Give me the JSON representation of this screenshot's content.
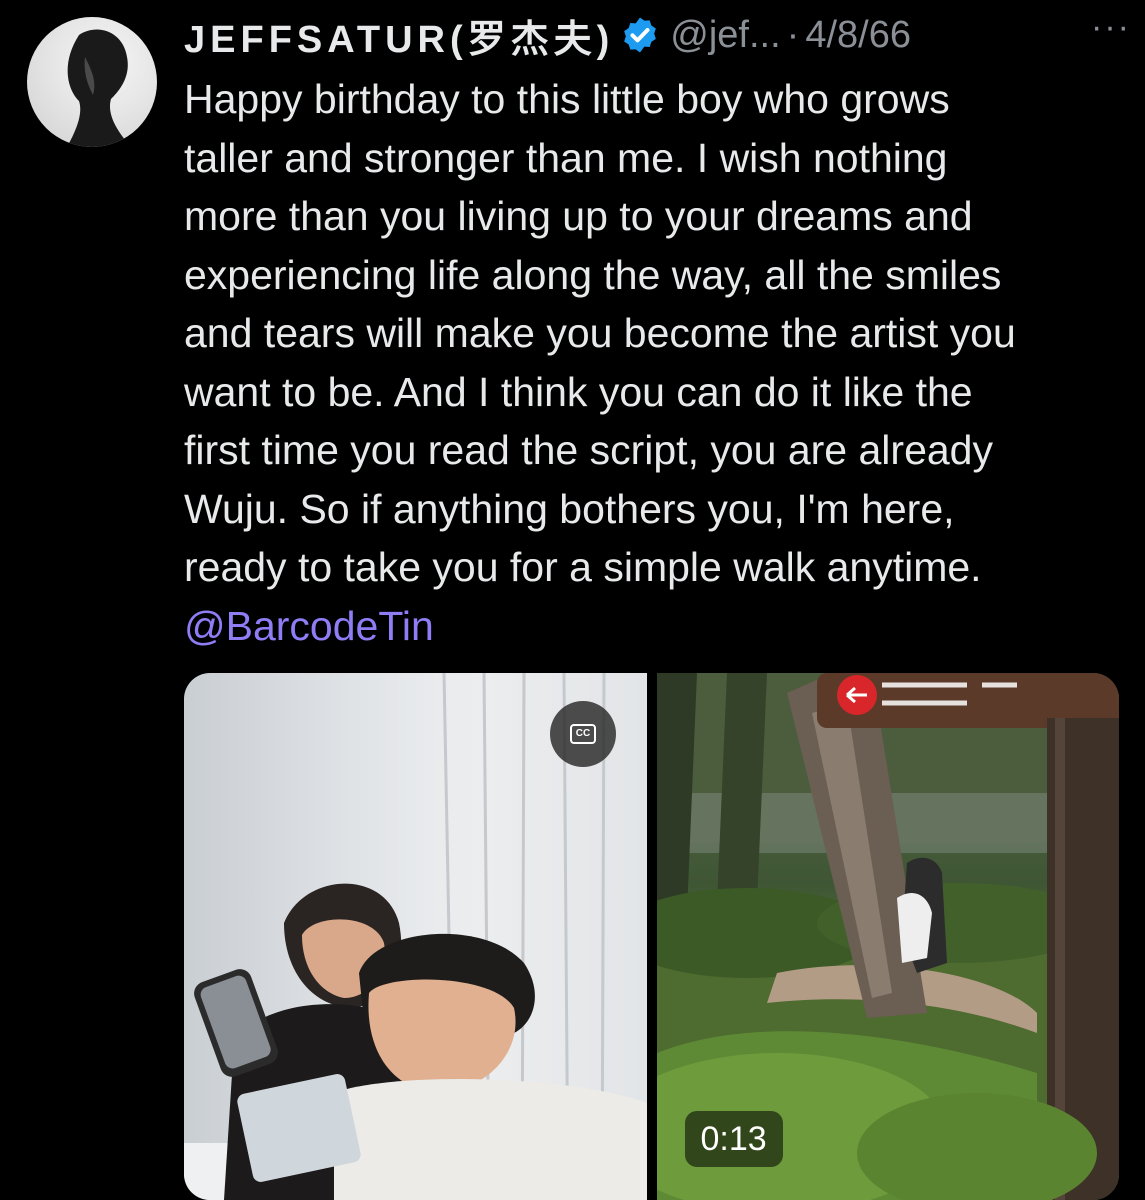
{
  "tweet": {
    "author": {
      "display_name": "JEFFSATUR(罗杰夫)",
      "handle": "@jef...",
      "verified": true,
      "avatar_icon": "profile-photo"
    },
    "separator": "·",
    "date": "4/8/66",
    "more_label": "···",
    "text_lines": [
      "Happy birthday to this little boy who grows",
      "taller and stronger than me. I wish nothing",
      "more than you living up to your dreams and",
      "experiencing life along the way, all the smiles",
      "and tears will make you become the artist you",
      "want to be. And I think you can do it like the",
      "first time you read the script, you are already",
      "Wuju. So if anything bothers you, I'm here,",
      "ready to take you for a simple walk anytime."
    ],
    "mention": "@BarcodeTin",
    "media": {
      "cc_label": "CC",
      "duration": "0:13"
    }
  },
  "colors": {
    "background": "#000000",
    "text": "#e7e9ea",
    "secondary_text": "#8b9096",
    "mention": "#8e7df5",
    "verified_badge": "#1d9bf0"
  }
}
